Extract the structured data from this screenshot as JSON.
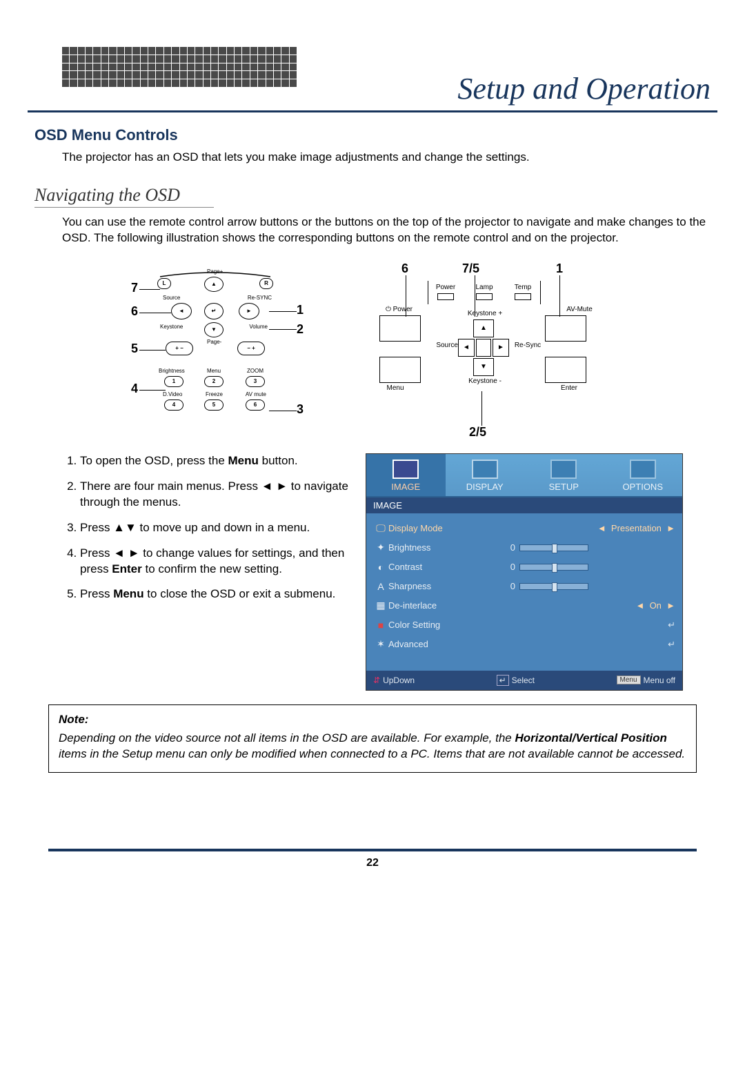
{
  "header": {
    "title": "Setup and Operation"
  },
  "section": {
    "heading": "OSD Menu Controls",
    "intro": "The projector has an OSD that lets you make image adjustments and change the settings.",
    "nav_heading": "Navigating the OSD",
    "nav_intro": "You can use the remote control arrow buttons or the buttons on the top of the projector to navigate and make changes to the OSD. The following illustration shows the corresponding buttons on the remote control and on the projector."
  },
  "diagram": {
    "remote": {
      "callouts_left": [
        "7",
        "6",
        "5",
        "4"
      ],
      "callouts_right": [
        "1",
        "2",
        "3"
      ],
      "labels": {
        "source": "Source",
        "resync": "Re-SYNC",
        "keystone": "Keystone",
        "page_up": "Page+",
        "page_dn": "Page-",
        "volume": "Volume",
        "brightness": "Brightness",
        "menu": "Menu",
        "zoom": "ZOOM",
        "dvideo": "D.Video",
        "freeze": "Freeze",
        "avmute": "AV mute",
        "L": "L",
        "R": "R"
      }
    },
    "panel": {
      "callouts": {
        "tl": "6",
        "tc": "7/5",
        "tr": "1",
        "bc": "2/5"
      },
      "leds": [
        "Power",
        "Lamp",
        "Temp"
      ],
      "btns": {
        "power": "Power",
        "avmute": "AV-Mute",
        "menu": "Menu",
        "enter": "Enter",
        "source": "Source",
        "resync": "Re-Sync",
        "keyplus": "Keystone +",
        "keyminus": "Keystone -"
      }
    }
  },
  "steps": [
    {
      "pre": "To open the OSD, press the ",
      "bold": "Menu",
      "post": " button."
    },
    {
      "pre": "There are four main menus. Press ◄ ► to navigate through the menus."
    },
    {
      "pre": "Press ▲▼ to move up and down in a menu."
    },
    {
      "pre": "Press ◄ ► to change values for settings, and then press ",
      "bold": "Enter",
      "post": " to confirm the new setting."
    },
    {
      "pre": "Press ",
      "bold": "Menu",
      "post": " to close the OSD or exit a submenu."
    }
  ],
  "osd": {
    "tabs": [
      "IMAGE",
      "DISPLAY",
      "SETUP",
      "OPTIONS"
    ],
    "active_tab": "IMAGE",
    "subhead": "IMAGE",
    "rows": [
      {
        "icon": "🖵",
        "name": "Display Mode",
        "value": "Presentation",
        "type": "select",
        "selected": true
      },
      {
        "icon": "✦",
        "name": "Brightness",
        "value": "0",
        "type": "slider"
      },
      {
        "icon": "◐",
        "name": "Contrast",
        "value": "0",
        "type": "slider"
      },
      {
        "icon": "A",
        "name": "Sharpness",
        "value": "0",
        "type": "slider"
      },
      {
        "icon": "▦",
        "name": "De-interlace",
        "value": "On",
        "type": "select"
      },
      {
        "icon": "■",
        "name": "Color Setting",
        "value": "",
        "type": "enter"
      },
      {
        "icon": "✶",
        "name": "Advanced",
        "value": "",
        "type": "enter"
      }
    ],
    "footer": {
      "updown": "UpDown",
      "select": "Select",
      "menuoff": "Menu off",
      "menu_key": "Menu"
    }
  },
  "note": {
    "title": "Note:",
    "body_pre": "Depending on the video source not all items in the OSD are available. For example, the ",
    "body_bold": "Horizontal/Vertical Position",
    "body_post": " items in the Setup menu can only be modified when connected to a PC. Items that are not available cannot be accessed."
  },
  "page_number": "22"
}
